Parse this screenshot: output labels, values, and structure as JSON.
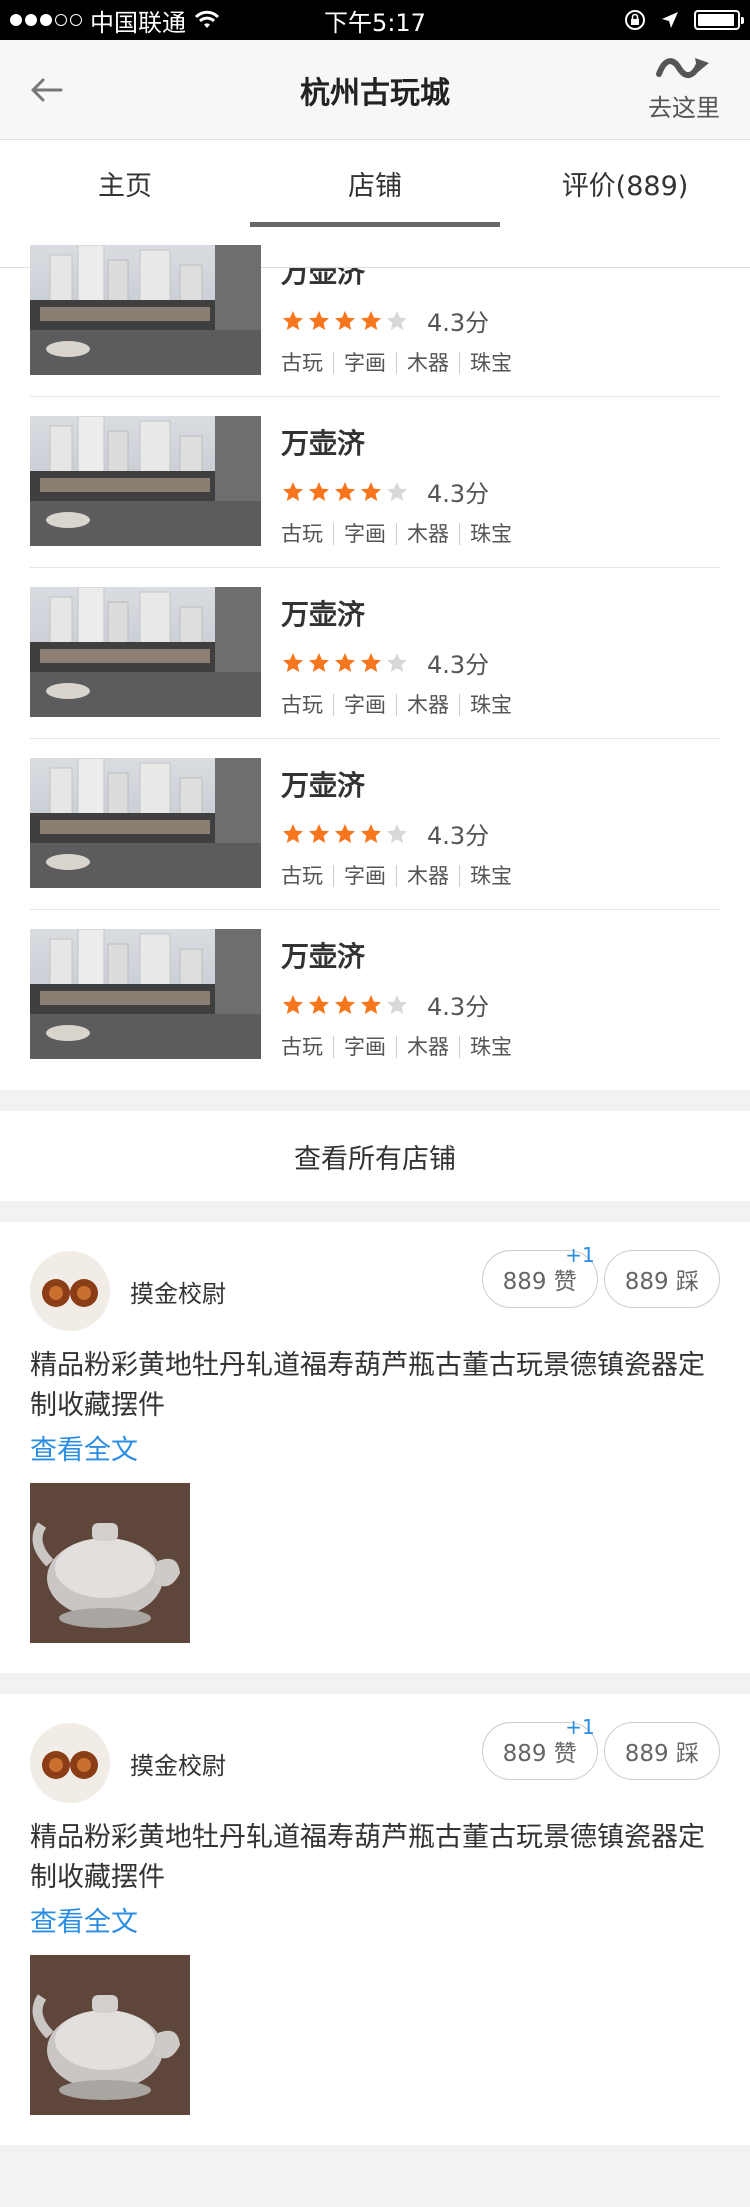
{
  "status_bar": {
    "carrier": "中国联通",
    "time": "下午5:17",
    "battery_level_percent": 95
  },
  "nav": {
    "title": "杭州古玩城",
    "goto_label": "去这里"
  },
  "tabs": [
    {
      "label": "主页",
      "active": false
    },
    {
      "label": "店铺",
      "active": true
    },
    {
      "label": "评价(889)",
      "active": false
    }
  ],
  "shops": [
    {
      "name": "万壶济",
      "rating": 4,
      "score": "4.3分",
      "tags": [
        "古玩",
        "字画",
        "木器",
        "珠宝"
      ]
    },
    {
      "name": "万壶济",
      "rating": 4,
      "score": "4.3分",
      "tags": [
        "古玩",
        "字画",
        "木器",
        "珠宝"
      ]
    },
    {
      "name": "万壶济",
      "rating": 4,
      "score": "4.3分",
      "tags": [
        "古玩",
        "字画",
        "木器",
        "珠宝"
      ]
    },
    {
      "name": "万壶济",
      "rating": 4,
      "score": "4.3分",
      "tags": [
        "古玩",
        "字画",
        "木器",
        "珠宝"
      ]
    },
    {
      "name": "万壶济",
      "rating": 4,
      "score": "4.3分",
      "tags": [
        "古玩",
        "字画",
        "木器",
        "珠宝"
      ]
    }
  ],
  "view_all_label": "查看所有店铺",
  "reviews": [
    {
      "user": "摸金校尉",
      "like_label": "889 赞",
      "like_plus": "+1",
      "dislike_label": "889 踩",
      "title": "精品粉彩黄地牡丹轧道福寿葫芦瓶古董古玩景德镇瓷器定制收藏摆件",
      "more_label": "查看全文"
    },
    {
      "user": "摸金校尉",
      "like_label": "889 赞",
      "like_plus": "+1",
      "dislike_label": "889 踩",
      "title": "精品粉彩黄地牡丹轧道福寿葫芦瓶古董古玩景德镇瓷器定制收藏摆件",
      "more_label": "查看全文"
    }
  ],
  "colors": {
    "star_active": "#f5761d",
    "star_inactive": "#d8d8d8",
    "link": "#2b8de4"
  }
}
